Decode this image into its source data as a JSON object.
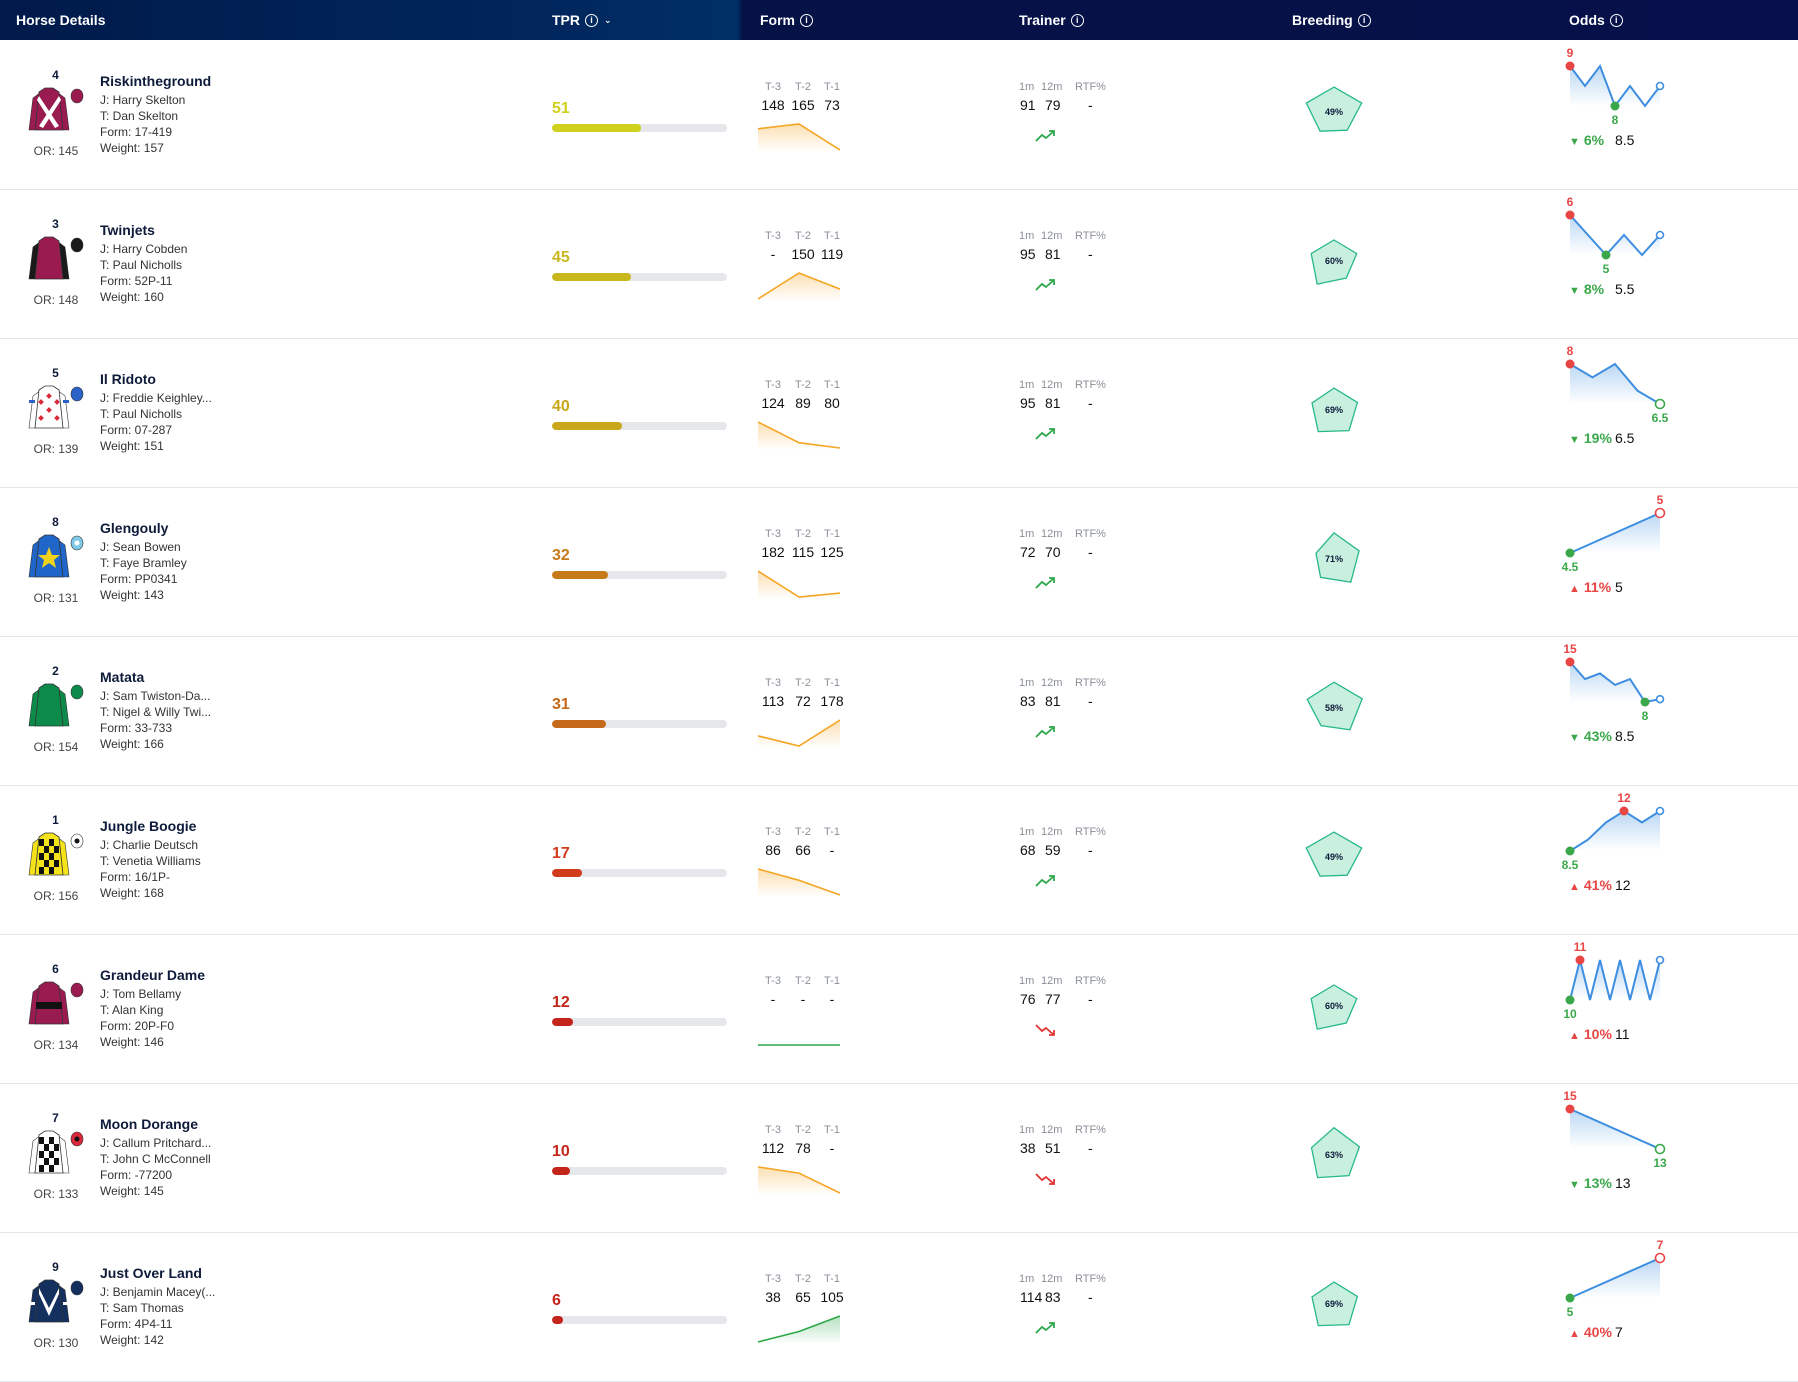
{
  "header": {
    "horse_details": "Horse Details",
    "tpr": "TPR",
    "form": "Form",
    "trainer": "Trainer",
    "breeding": "Breeding",
    "odds": "Odds",
    "info_glyph": "i",
    "sort_glyph": "⌄"
  },
  "labels": {
    "t3": "T-3",
    "t2": "T-2",
    "t1": "T-1",
    "m1": "1m",
    "m12": "12m",
    "rtf": "RTF%"
  },
  "colors": {
    "header_dark": "#07104a",
    "tpr_scale": [
      "#cfd11a",
      "#c8b81e",
      "#c9a71a",
      "#c77a1a",
      "#c46a1a",
      "#d13a1a",
      "#c4251a",
      "#c4251a",
      "#c4251a"
    ],
    "form_orange": "#f5a524",
    "form_green": "#2ea84a",
    "odds_line": "#3d8ee0",
    "odds_red": "#e84545",
    "odds_green": "#3aa84a",
    "breed_fill": "#c9efdf",
    "breed_stroke": "#27b98a"
  },
  "horses": [
    {
      "no": "4",
      "silk": "maroon-white-cross",
      "name": "Riskintheground",
      "jockey": "J: Harry Skelton",
      "trainer": "T: Dan Skelton",
      "form": "Form: 17-419",
      "weight": "Weight: 157",
      "or": "OR: 145",
      "tpr": "51",
      "tpr_pct": 0.51,
      "t3": "148",
      "t2": "165",
      "t1": "73",
      "form_pts": [
        148,
        165,
        73
      ],
      "form_color": "orange",
      "m1": "91",
      "m12": "79",
      "rtf": "-",
      "trend": "up",
      "breeding": "49%",
      "breed_val": 0.49,
      "odds_series": [
        9,
        8.5,
        9,
        8,
        8.5,
        8,
        8.5
      ],
      "odds_hi": "9",
      "odds_lo": "8",
      "odds_pct": "6%",
      "odds_dir": "down",
      "odds_cur": "8.5"
    },
    {
      "no": "3",
      "silk": "maroon-black-sleeves",
      "name": "Twinjets",
      "jockey": "J: Harry Cobden",
      "trainer": "T: Paul Nicholls",
      "form": "Form: 52P-11",
      "weight": "Weight: 160",
      "or": "OR: 148",
      "tpr": "45",
      "tpr_pct": 0.45,
      "t3": "-",
      "t2": "150",
      "t1": "119",
      "form_pts": [
        100,
        150,
        119
      ],
      "form_color": "orange",
      "m1": "95",
      "m12": "81",
      "rtf": "-",
      "trend": "up",
      "breeding": "60%",
      "breed_val": 0.6,
      "odds_series": [
        6,
        5.5,
        5,
        5.5,
        5,
        5.5
      ],
      "odds_hi": "6",
      "odds_lo": "5",
      "odds_pct": "8%",
      "odds_dir": "down",
      "odds_cur": "5.5"
    },
    {
      "no": "5",
      "silk": "white-red-diamonds",
      "name": "Il Ridoto",
      "jockey": "J: Freddie Keighley...",
      "trainer": "T: Paul Nicholls",
      "form": "Form: 07-287",
      "weight": "Weight: 151",
      "or": "OR: 139",
      "tpr": "40",
      "tpr_pct": 0.4,
      "t3": "124",
      "t2": "89",
      "t1": "80",
      "form_pts": [
        124,
        89,
        80
      ],
      "form_color": "orange",
      "m1": "95",
      "m12": "81",
      "rtf": "-",
      "trend": "up",
      "breeding": "69%",
      "breed_val": 0.69,
      "odds_series": [
        8,
        7.5,
        8,
        7,
        6.5
      ],
      "odds_hi": "8",
      "odds_lo": "6.5",
      "odds_pct": "19%",
      "odds_dir": "down",
      "odds_cur": "6.5"
    },
    {
      "no": "8",
      "silk": "blue-yellow-star",
      "name": "Glengouly",
      "jockey": "J: Sean Bowen",
      "trainer": "T: Faye Bramley",
      "form": "Form: PP0341",
      "weight": "Weight: 143",
      "or": "OR: 131",
      "tpr": "32",
      "tpr_pct": 0.32,
      "t3": "182",
      "t2": "115",
      "t1": "125",
      "form_pts": [
        182,
        115,
        125
      ],
      "form_color": "orange",
      "m1": "72",
      "m12": "70",
      "rtf": "-",
      "trend": "up",
      "breeding": "71%",
      "breed_val": 0.71,
      "odds_series": [
        4.5,
        5
      ],
      "odds_hi": "5",
      "odds_lo": "4.5",
      "odds_pct": "11%",
      "odds_dir": "up",
      "odds_cur": "5"
    },
    {
      "no": "2",
      "silk": "green",
      "name": "Matata",
      "jockey": "J: Sam Twiston-Da...",
      "trainer": "T: Nigel & Willy Twi...",
      "form": "Form: 33-733",
      "weight": "Weight: 166",
      "or": "OR: 154",
      "tpr": "31",
      "tpr_pct": 0.31,
      "t3": "113",
      "t2": "72",
      "t1": "178",
      "form_pts": [
        113,
        72,
        178
      ],
      "form_color": "orange",
      "m1": "83",
      "m12": "81",
      "rtf": "-",
      "trend": "up",
      "breeding": "58%",
      "breed_val": 0.58,
      "odds_series": [
        15,
        12,
        13,
        11,
        12,
        8,
        8.5
      ],
      "odds_hi": "15",
      "odds_lo": "8",
      "odds_pct": "43%",
      "odds_dir": "down",
      "odds_cur": "8.5"
    },
    {
      "no": "1",
      "silk": "yellow-black-check",
      "name": "Jungle Boogie",
      "jockey": "J: Charlie Deutsch",
      "trainer": "T: Venetia Williams",
      "form": "Form: 16/1P-",
      "weight": "Weight: 168",
      "or": "OR: 156",
      "tpr": "17",
      "tpr_pct": 0.17,
      "t3": "86",
      "t2": "66",
      "t1": "-",
      "form_pts": [
        86,
        66,
        40
      ],
      "form_color": "orange",
      "m1": "68",
      "m12": "59",
      "rtf": "-",
      "trend": "up",
      "breeding": "49%",
      "breed_val": 0.49,
      "odds_series": [
        8.5,
        9.5,
        11,
        12,
        11,
        12
      ],
      "odds_hi": "12",
      "odds_lo": "8.5",
      "odds_pct": "41%",
      "odds_dir": "up",
      "odds_cur": "12"
    },
    {
      "no": "6",
      "silk": "maroon-black-band",
      "name": "Grandeur Dame",
      "jockey": "J: Tom Bellamy",
      "trainer": "T: Alan King",
      "form": "Form: 20P-F0",
      "weight": "Weight: 146",
      "or": "OR: 134",
      "tpr": "12",
      "tpr_pct": 0.12,
      "t3": "-",
      "t2": "-",
      "t1": "-",
      "form_pts": [
        0,
        0,
        0
      ],
      "form_color": "green",
      "m1": "76",
      "m12": "77",
      "rtf": "-",
      "trend": "down",
      "breeding": "60%",
      "breed_val": 0.6,
      "odds_series": [
        10,
        11,
        10,
        11,
        10,
        11,
        10,
        11,
        10,
        11
      ],
      "odds_hi": "11",
      "odds_lo": "10",
      "odds_pct": "10%",
      "odds_dir": "up",
      "odds_cur": "11"
    },
    {
      "no": "7",
      "silk": "white-black-diamonds",
      "name": "Moon Dorange",
      "jockey": "J: Callum Pritchard...",
      "trainer": "T: John C McConnell",
      "form": "Form: -77200",
      "weight": "Weight: 145",
      "or": "OR: 133",
      "tpr": "10",
      "tpr_pct": 0.1,
      "t3": "112",
      "t2": "78",
      "t1": "-",
      "form_pts": [
        112,
        95,
        40
      ],
      "form_color": "orange",
      "m1": "38",
      "m12": "51",
      "rtf": "-",
      "trend": "down",
      "breeding": "63%",
      "breed_val": 0.63,
      "odds_series": [
        15,
        13
      ],
      "odds_hi": "15",
      "odds_lo": "13",
      "odds_pct": "13%",
      "odds_dir": "down",
      "odds_cur": "13"
    },
    {
      "no": "9",
      "silk": "navy-white-chevron",
      "name": "Just Over Land",
      "jockey": "J: Benjamin Macey(...",
      "trainer": "T: Sam Thomas",
      "form": "Form: 4P4-11",
      "weight": "Weight: 142",
      "or": "OR: 130",
      "tpr": "6",
      "tpr_pct": 0.06,
      "t3": "38",
      "t2": "65",
      "t1": "105",
      "form_pts": [
        38,
        65,
        105
      ],
      "form_color": "green",
      "m1": "114",
      "m12": "83",
      "rtf": "-",
      "trend": "up",
      "breeding": "69%",
      "breed_val": 0.69,
      "odds_series": [
        5,
        7
      ],
      "odds_hi": "7",
      "odds_lo": "5",
      "odds_pct": "40%",
      "odds_dir": "up",
      "odds_cur": "7"
    }
  ]
}
